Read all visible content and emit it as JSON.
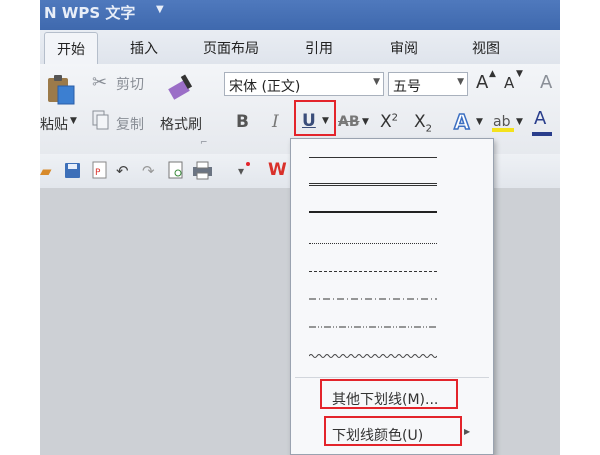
{
  "window": {
    "title": "N WPS 文字"
  },
  "tabs": [
    "开始",
    "插入",
    "页面布局",
    "引用",
    "审阅",
    "视图"
  ],
  "ribbon": {
    "paste_label": "粘贴",
    "cut_label": "剪切",
    "copy_label": "复制",
    "format_painter_label": "格式刷",
    "font_name": "宋体 (正文)",
    "font_size": "五号",
    "grow_font": "A",
    "shrink_font": "A",
    "bold": "B",
    "italic": "I",
    "underline": "U",
    "strikethrough": "AB",
    "superscript": "X",
    "subscript": "X",
    "text_effect": "A",
    "font_color": "A"
  },
  "underline_menu": {
    "styles": [
      "single",
      "double",
      "thick",
      "dotted",
      "dashed",
      "dash-dot",
      "dash-dot-dot",
      "wave"
    ],
    "more_label": "其他下划线(M)...",
    "color_label": "下划线颜色(U)"
  },
  "colors": {
    "highlight": "#e3242b",
    "accent": "#3f69ae"
  }
}
